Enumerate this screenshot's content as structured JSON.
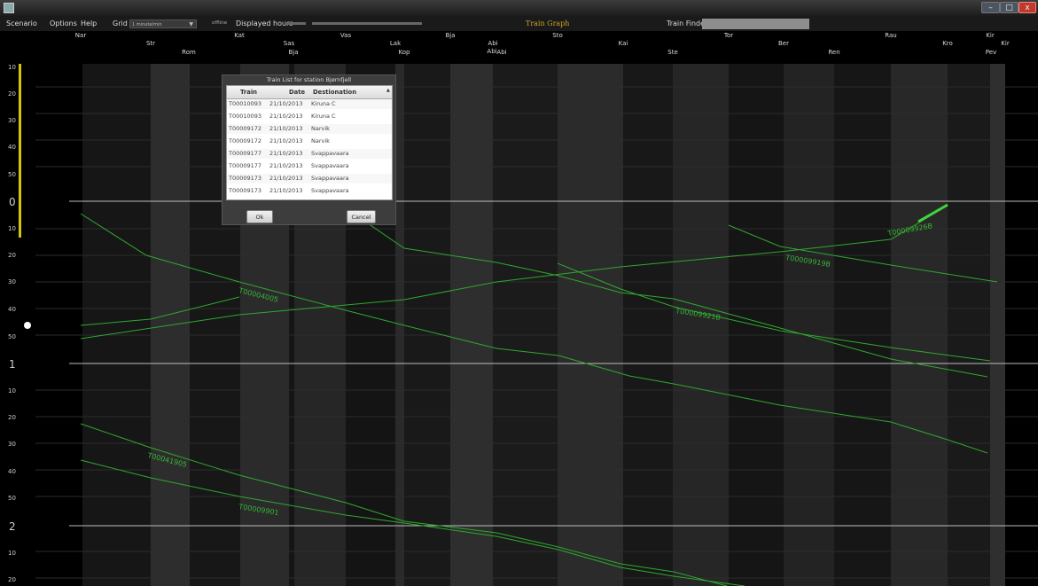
{
  "window": {
    "min_glyph": "–",
    "max_glyph": "□",
    "close_glyph": "x"
  },
  "menu": {
    "scenario": "Scenario",
    "options": "Options",
    "help": "Help",
    "grid_label": "Grid",
    "grid_value": "1 minute/min",
    "offline": "offline",
    "displayed_hours": "Displayed hours",
    "graph_title": "Train Graph",
    "train_finder": "Train Finder"
  },
  "stations_row1": [
    "Nar",
    "Kat",
    "Vas",
    "Lak",
    "Bja",
    "Abi",
    "Sto",
    "Tor",
    "Ber",
    "Rau",
    "Kir"
  ],
  "stations_row2": [
    "Str",
    "Sas",
    "Abi",
    "Kai",
    "Kro",
    "Kir"
  ],
  "stations_row3": [
    "Rom",
    "Bja",
    "Kop",
    "Abi",
    "Ste",
    "Ren",
    "Pev"
  ],
  "time_axis": [
    "10",
    "20",
    "30",
    "40",
    "50",
    "0",
    "10",
    "20",
    "30",
    "40",
    "50",
    "1",
    "10",
    "20",
    "30",
    "40",
    "50",
    "2",
    "10",
    "20"
  ],
  "train_labels": [
    "T00004005",
    "T00009921B",
    "T00009919B",
    "T00009926B",
    "T00041905",
    "T00009901"
  ],
  "dialog": {
    "title": "Train List for station Bjørnfjell",
    "columns": [
      "Train",
      "Date",
      "Destionation"
    ],
    "rows": [
      [
        "T00010093",
        "21/10/2013",
        "Kiruna C"
      ],
      [
        "T00010093",
        "21/10/2013",
        "Kiruna C"
      ],
      [
        "T00009172",
        "21/10/2013",
        "Narvik"
      ],
      [
        "T00009172",
        "21/10/2013",
        "Narvik"
      ],
      [
        "T00009177",
        "21/10/2013",
        "Svappavaara"
      ],
      [
        "T00009177",
        "21/10/2013",
        "Svappavaara"
      ],
      [
        "T00009173",
        "21/10/2013",
        "Svappavaara"
      ],
      [
        "T00009173",
        "21/10/2013",
        "Svappavaara"
      ]
    ],
    "ok": "Ok",
    "cancel": "Cancel",
    "sort_glyph": "▲"
  },
  "colors": {
    "line": "#2fa82f",
    "label": "#35b535",
    "title_accent": "#c9a227",
    "bar": "#d4c700"
  }
}
